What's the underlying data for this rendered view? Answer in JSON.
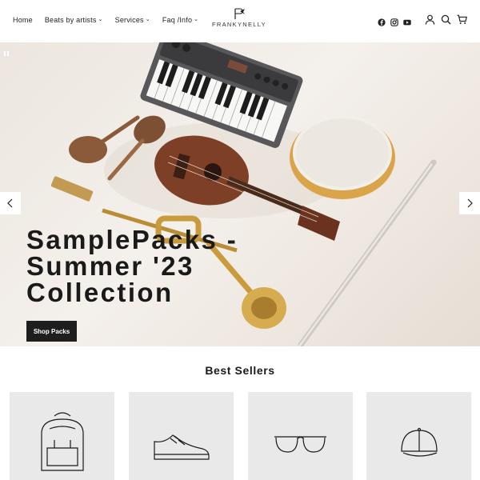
{
  "header": {
    "nav": [
      {
        "label": "Home",
        "has_dropdown": false
      },
      {
        "label": "Beats by artists",
        "has_dropdown": true
      },
      {
        "label": "Services",
        "has_dropdown": true
      },
      {
        "label": "Faq /Info",
        "has_dropdown": true
      }
    ],
    "logo_text": "FRANKYNELLY",
    "social_icons": [
      "facebook-icon",
      "instagram-icon",
      "youtube-icon"
    ],
    "utility_icons": [
      "account-icon",
      "search-icon",
      "cart-icon"
    ]
  },
  "hero": {
    "title": "SamplePacks - Summer '23 Collection",
    "button_label": "Shop Packs",
    "controls": [
      "pause-icon",
      "arrow-left-icon",
      "arrow-right-icon"
    ]
  },
  "best_sellers": {
    "title": "Best Sellers",
    "products": [
      {
        "icon": "backpack-icon"
      },
      {
        "icon": "sneaker-icon"
      },
      {
        "icon": "sunglasses-icon"
      },
      {
        "icon": "cap-icon"
      }
    ]
  },
  "colors": {
    "background": "#ffffff",
    "button_bg": "#1e1e1e",
    "product_card_bg": "#e9e9e9",
    "text": "#1a1a1a"
  }
}
